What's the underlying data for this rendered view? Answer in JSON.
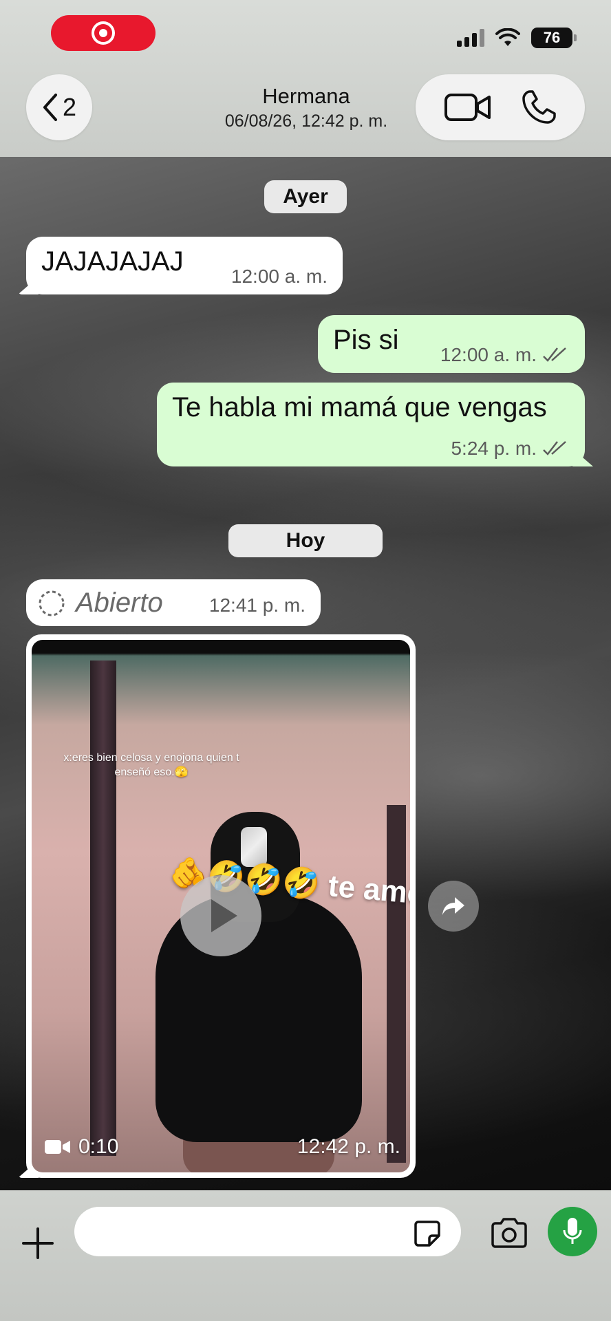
{
  "status_bar": {
    "battery": "76"
  },
  "header": {
    "back_count": "2",
    "contact_name": "Hermana",
    "contact_status": "06/08/26, 12:42 p. m."
  },
  "chat": {
    "date_chip_1": "Ayer",
    "date_chip_2": "Hoy",
    "messages": [
      {
        "direction": "in",
        "text": "JAJAJAJAJ",
        "time": "12:00 a. m."
      },
      {
        "direction": "out",
        "text": "Pis si",
        "time": "12:00 a. m.",
        "status": "read"
      },
      {
        "direction": "out",
        "text": "Te habla mi mamá que vengas",
        "time": "5:24 p. m.",
        "status": "read"
      }
    ],
    "view_once": {
      "label": "Abierto",
      "time": "12:41 p. m."
    },
    "video": {
      "caption_overlay": "x:eres bien celosa y enojona quien t enseñó eso.🫣",
      "sticker_text": "🫵🤣🤣🤣 te amo 💕",
      "duration": "0:10",
      "time": "12:42 p. m."
    }
  },
  "composer": {
    "placeholder": "",
    "value": ""
  },
  "colors": {
    "outgoing_bubble": "#d9fdd3",
    "incoming_bubble": "#ffffff",
    "mic_button": "#25a244",
    "record_pill": "#e8182d"
  },
  "icons": [
    "record-icon",
    "signal-icon",
    "wifi-icon",
    "battery-icon",
    "chevron-left-icon",
    "video-call-icon",
    "phone-icon",
    "double-check-icon",
    "view-once-icon",
    "play-icon",
    "video-camera-icon",
    "forward-icon",
    "plus-icon",
    "sticker-icon",
    "camera-icon",
    "mic-icon"
  ]
}
